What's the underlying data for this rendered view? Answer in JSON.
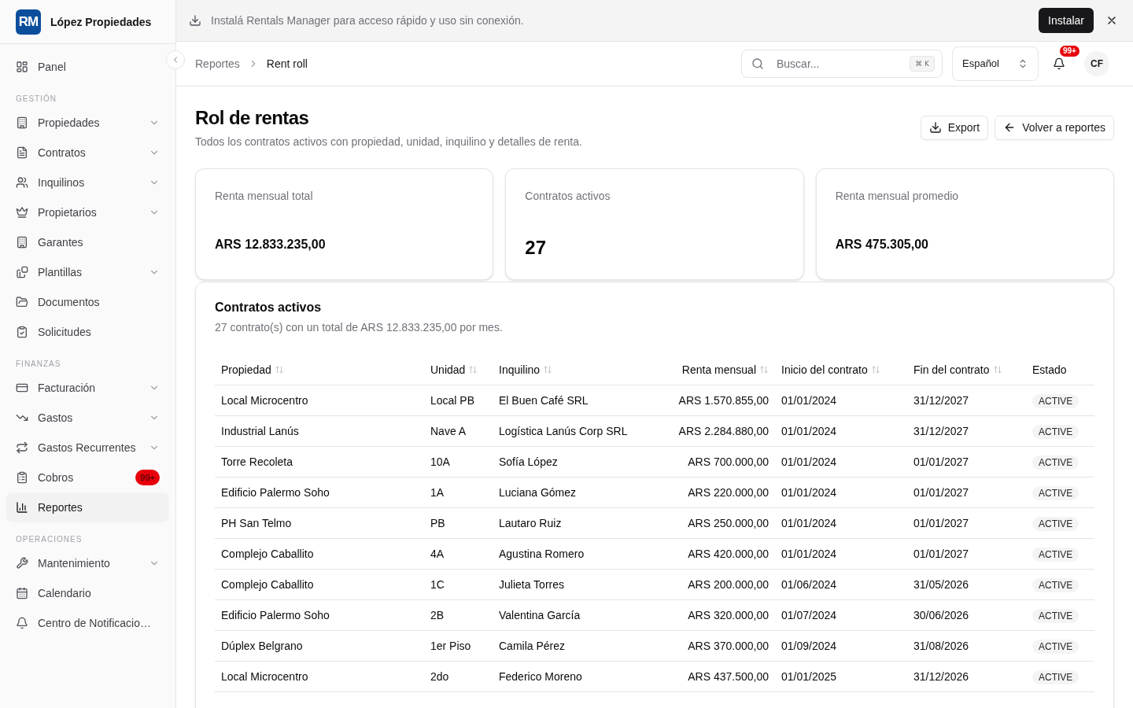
{
  "sidebar": {
    "brand": {
      "logo": "RM",
      "name": "López Propiedades"
    },
    "top_items": [
      {
        "label": "Panel",
        "expandable": false,
        "selected": false
      }
    ],
    "sections": [
      {
        "title": "GESTIÓN",
        "items": [
          {
            "label": "Propiedades",
            "expandable": true,
            "selected": false
          },
          {
            "label": "Contratos",
            "expandable": true,
            "selected": false
          },
          {
            "label": "Inquilinos",
            "expandable": true,
            "selected": false
          },
          {
            "label": "Propietarios",
            "expandable": true,
            "selected": false
          },
          {
            "label": "Garantes",
            "expandable": false,
            "selected": false
          },
          {
            "label": "Plantillas",
            "expandable": true,
            "selected": false
          },
          {
            "label": "Documentos",
            "expandable": false,
            "selected": false
          },
          {
            "label": "Solicitudes",
            "expandable": false,
            "selected": false
          }
        ]
      },
      {
        "title": "FINANZAS",
        "items": [
          {
            "label": "Facturación",
            "expandable": true,
            "selected": false
          },
          {
            "label": "Gastos",
            "expandable": true,
            "selected": false
          },
          {
            "label": "Gastos Recurrentes",
            "expandable": true,
            "selected": false
          },
          {
            "label": "Cobros",
            "expandable": false,
            "selected": false,
            "badge": "99+"
          },
          {
            "label": "Reportes",
            "expandable": false,
            "selected": true
          }
        ]
      },
      {
        "title": "OPERACIONES",
        "items": [
          {
            "label": "Mantenimiento",
            "expandable": true,
            "selected": false
          },
          {
            "label": "Calendario",
            "expandable": false,
            "selected": false
          },
          {
            "label": "Centro de Notificacio…",
            "expandable": false,
            "selected": false
          }
        ]
      }
    ]
  },
  "install_banner": {
    "message": "Instalá Rentals Manager para acceso rápido y uso sin conexión.",
    "button": "Instalar"
  },
  "header": {
    "breadcrumb": [
      {
        "label": "Reportes",
        "current": false
      },
      {
        "label": "Rent roll",
        "current": true
      }
    ],
    "search": {
      "placeholder": "Buscar...",
      "shortcut": "⌘ K"
    },
    "language": "Español",
    "notifications_badge": "99+",
    "avatar": "CF"
  },
  "page": {
    "title": "Rol de rentas",
    "subtitle": "Todos los contratos activos con propiedad, unidad, inquilino y detalles de renta.",
    "actions": [
      {
        "label": "Export"
      },
      {
        "label": "Volver a reportes"
      }
    ]
  },
  "stats": [
    {
      "label": "Renta mensual total",
      "value": "ARS 12.833.235,00",
      "kind": "money"
    },
    {
      "label": "Contratos activos",
      "value": "27",
      "kind": "count"
    },
    {
      "label": "Renta mensual promedio",
      "value": "ARS 475.305,00",
      "kind": "money"
    }
  ],
  "table": {
    "title": "Contratos activos",
    "subtitle": "27 contrato(s) con un total de ARS 12.833.235,00 por mes.",
    "columns": [
      {
        "label": "Propiedad",
        "sortable": true,
        "kind": "text"
      },
      {
        "label": "Unidad",
        "sortable": true,
        "kind": "text"
      },
      {
        "label": "Inquilino",
        "sortable": true,
        "kind": "text"
      },
      {
        "label": "Renta mensual",
        "sortable": true,
        "kind": "money"
      },
      {
        "label": "Inicio del contrato",
        "sortable": true,
        "kind": "text"
      },
      {
        "label": "Fin del contrato",
        "sortable": true,
        "kind": "text"
      },
      {
        "label": "Estado",
        "sortable": false,
        "kind": "status"
      }
    ],
    "rows": [
      [
        "Local Microcentro",
        "Local PB",
        "El Buen Café SRL",
        "ARS 1.570.855,00",
        "01/01/2024",
        "31/12/2027",
        "ACTIVE"
      ],
      [
        "Industrial Lanús",
        "Nave A",
        "Logística Lanús Corp SRL",
        "ARS 2.284.880,00",
        "01/01/2024",
        "31/12/2027",
        "ACTIVE"
      ],
      [
        "Torre Recoleta",
        "10A",
        "Sofía López",
        "ARS 700.000,00",
        "01/01/2024",
        "01/01/2027",
        "ACTIVE"
      ],
      [
        "Edificio Palermo Soho",
        "1A",
        "Luciana Gómez",
        "ARS 220.000,00",
        "01/01/2024",
        "01/01/2027",
        "ACTIVE"
      ],
      [
        "PH San Telmo",
        "PB",
        "Lautaro Ruiz",
        "ARS 250.000,00",
        "01/01/2024",
        "01/01/2027",
        "ACTIVE"
      ],
      [
        "Complejo Caballito",
        "4A",
        "Agustina Romero",
        "ARS 420.000,00",
        "01/01/2024",
        "01/01/2027",
        "ACTIVE"
      ],
      [
        "Complejo Caballito",
        "1C",
        "Julieta Torres",
        "ARS 200.000,00",
        "01/06/2024",
        "31/05/2026",
        "ACTIVE"
      ],
      [
        "Edificio Palermo Soho",
        "2B",
        "Valentina García",
        "ARS 320.000,00",
        "01/07/2024",
        "30/06/2026",
        "ACTIVE"
      ],
      [
        "Dúplex Belgrano",
        "1er Piso",
        "Camila Pérez",
        "ARS 370.000,00",
        "01/09/2024",
        "31/08/2026",
        "ACTIVE"
      ],
      [
        "Local Microcentro",
        "2do",
        "Federico Moreno",
        "ARS 437.500,00",
        "01/01/2025",
        "31/12/2026",
        "ACTIVE"
      ]
    ]
  }
}
